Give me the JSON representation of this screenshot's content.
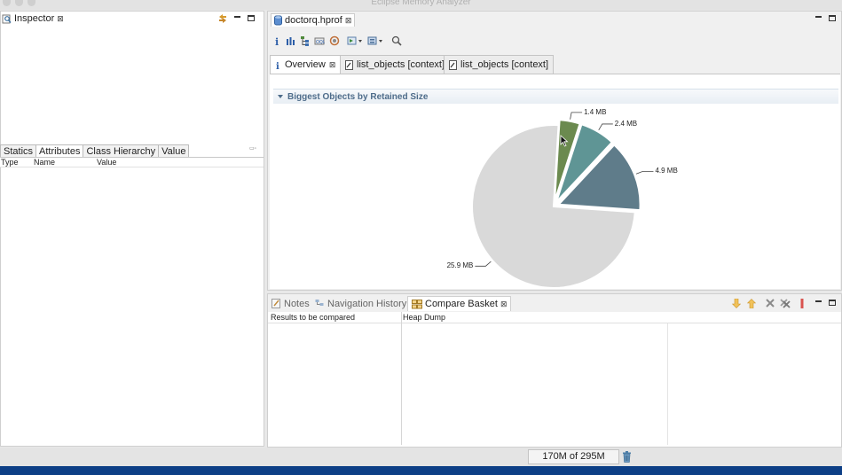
{
  "window": {
    "title": "Eclipse Memory Analyzer"
  },
  "inspector": {
    "title": "Inspector",
    "tabs": [
      {
        "label": "Statics"
      },
      {
        "label": "Attributes"
      },
      {
        "label": "Class Hierarchy"
      },
      {
        "label": "Value"
      }
    ],
    "columns": [
      "Type",
      "Name",
      "Value"
    ]
  },
  "editor": {
    "file_tab": "doctorq.hprof",
    "tabs": [
      {
        "label": "Overview"
      },
      {
        "label": "list_objects [context]"
      },
      {
        "label": "list_objects [context]"
      }
    ],
    "section_title": "Biggest Objects by Retained Size"
  },
  "chart_data": {
    "type": "pie",
    "title": "Biggest Objects by Retained Size",
    "unit": "MB",
    "slices": [
      {
        "label": "1.4 MB",
        "value": 1.4,
        "color": "#6b8a4f"
      },
      {
        "label": "2.4 MB",
        "value": 2.4,
        "color": "#5f9595"
      },
      {
        "label": "4.9 MB",
        "value": 4.9,
        "color": "#5f7c8a"
      },
      {
        "label": "25.9 MB",
        "value": 25.9,
        "color": "#d9d9d9"
      }
    ]
  },
  "bottom": {
    "tabs": [
      {
        "label": "Notes"
      },
      {
        "label": "Navigation History"
      },
      {
        "label": "Compare Basket"
      }
    ],
    "columns": [
      "Results to be compared",
      "Heap Dump"
    ]
  },
  "status": {
    "heap": "170M of 295M"
  },
  "colors": {
    "taskbar": "#0d3f86",
    "section_title": "#4e6c8a"
  }
}
